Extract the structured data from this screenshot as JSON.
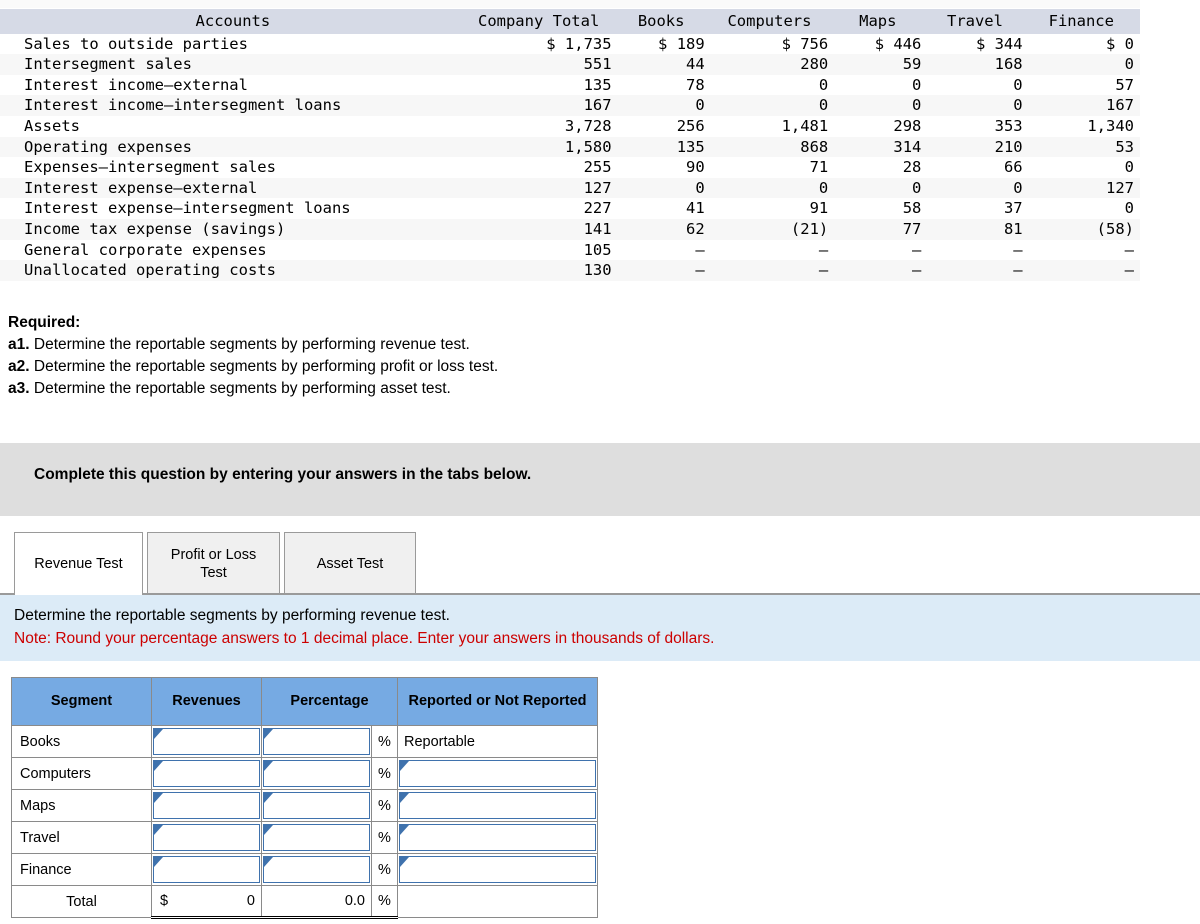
{
  "seg_table": {
    "columns": [
      "Accounts",
      "Company Total",
      "Books",
      "Computers",
      "Maps",
      "Travel",
      "Finance"
    ],
    "rows": [
      {
        "label": "Sales to outside parties",
        "total": "$ 1,735",
        "books": "$ 189",
        "computers": "$ 756",
        "maps": "$ 446",
        "travel": "$ 344",
        "finance": "$ 0"
      },
      {
        "label": "Intersegment sales",
        "total": "551",
        "books": "44",
        "computers": "280",
        "maps": "59",
        "travel": "168",
        "finance": "0"
      },
      {
        "label": "Interest income—external",
        "total": "135",
        "books": "78",
        "computers": "0",
        "maps": "0",
        "travel": "0",
        "finance": "57"
      },
      {
        "label": "Interest income—intersegment loans",
        "total": "167",
        "books": "0",
        "computers": "0",
        "maps": "0",
        "travel": "0",
        "finance": "167"
      },
      {
        "label": "Assets",
        "total": "3,728",
        "books": "256",
        "computers": "1,481",
        "maps": "298",
        "travel": "353",
        "finance": "1,340"
      },
      {
        "label": "Operating expenses",
        "total": "1,580",
        "books": "135",
        "computers": "868",
        "maps": "314",
        "travel": "210",
        "finance": "53"
      },
      {
        "label": "Expenses—intersegment sales",
        "total": "255",
        "books": "90",
        "computers": "71",
        "maps": "28",
        "travel": "66",
        "finance": "0"
      },
      {
        "label": "Interest expense—external",
        "total": "127",
        "books": "0",
        "computers": "0",
        "maps": "0",
        "travel": "0",
        "finance": "127"
      },
      {
        "label": "Interest expense—intersegment loans",
        "total": "227",
        "books": "41",
        "computers": "91",
        "maps": "58",
        "travel": "37",
        "finance": "0"
      },
      {
        "label": "Income tax expense (savings)",
        "total": "141",
        "books": "62",
        "computers": "(21)",
        "maps": "77",
        "travel": "81",
        "finance": "(58)"
      },
      {
        "label": "General corporate expenses",
        "total": "105",
        "books": "–",
        "computers": "–",
        "maps": "–",
        "travel": "–",
        "finance": "–"
      },
      {
        "label": "Unallocated operating costs",
        "total": "130",
        "books": "–",
        "computers": "–",
        "maps": "–",
        "travel": "–",
        "finance": "–"
      }
    ]
  },
  "required": {
    "title": "Required:",
    "items": [
      {
        "num": "a1.",
        "text": "Determine the reportable segments by performing revenue test."
      },
      {
        "num": "a2.",
        "text": "Determine the reportable segments by performing profit or loss test."
      },
      {
        "num": "a3.",
        "text": "Determine the reportable segments by performing asset test."
      }
    ]
  },
  "complete_panel": {
    "text": "Complete this question by entering your answers in the tabs below."
  },
  "tabs": [
    {
      "label": "Revenue Test",
      "active": true
    },
    {
      "label": "Profit or Loss Test",
      "active": false
    },
    {
      "label": "Asset Test",
      "active": false
    }
  ],
  "note_panel": {
    "instruction": "Determine the reportable segments by performing revenue test.",
    "note": "Note: Round your percentage answers to 1 decimal place. Enter your answers in thousands of dollars.",
    "note_color": "#cc0000",
    "background": "#dcebf7"
  },
  "answer_table": {
    "headers": {
      "segment": "Segment",
      "revenues": "Revenues",
      "percentage": "Percentage",
      "reported": "Reported or Not Reported"
    },
    "header_color": "#76aae3",
    "percent_symbol": "%",
    "rows": [
      {
        "segment": "Books",
        "revenues": "",
        "percentage": "",
        "reported": "Reportable",
        "reported_is_input": false
      },
      {
        "segment": "Computers",
        "revenues": "",
        "percentage": "",
        "reported": "",
        "reported_is_input": true
      },
      {
        "segment": "Maps",
        "revenues": "",
        "percentage": "",
        "reported": "",
        "reported_is_input": true
      },
      {
        "segment": "Travel",
        "revenues": "",
        "percentage": "",
        "reported": "",
        "reported_is_input": true
      },
      {
        "segment": "Finance",
        "revenues": "",
        "percentage": "",
        "reported": "",
        "reported_is_input": true
      }
    ],
    "total": {
      "label": "Total",
      "currency": "$",
      "revenues": "0",
      "percentage": "0.0"
    }
  }
}
